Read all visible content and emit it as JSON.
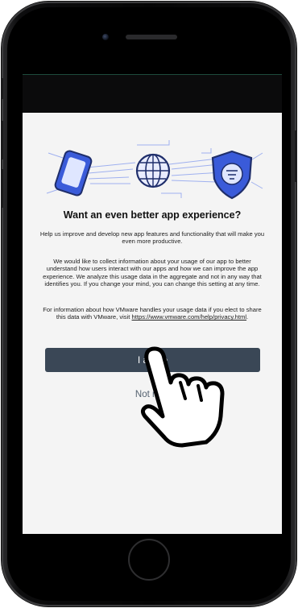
{
  "consent": {
    "title": "Want an even better app experience?",
    "intro": "Help us improve and develop new app features and functionality that will make you even more productive.",
    "details": "We would like to collect information about your usage of our app to better understand how users interact with our apps and how we can improve the app experience. We analyze this usage data in the aggregate and not in any way that identifies you. If you change your mind, you can change this setting at any time.",
    "privacy_text": "For information about how VMware handles your usage data if you elect to share this data with VMware, visit",
    "privacy_link": "https://www.vmware.com/help/privacy.html",
    "privacy_suffix": ".",
    "agree_label": "I agree",
    "not_now_label": "Not now"
  },
  "icons": [
    "phone-icon",
    "globe-icon",
    "shield-icon",
    "pointing-hand-icon"
  ],
  "colors": {
    "button": "#3a4756",
    "screen_bg": "#f4f4f4",
    "illustration_blue": "#3a5bd9"
  }
}
